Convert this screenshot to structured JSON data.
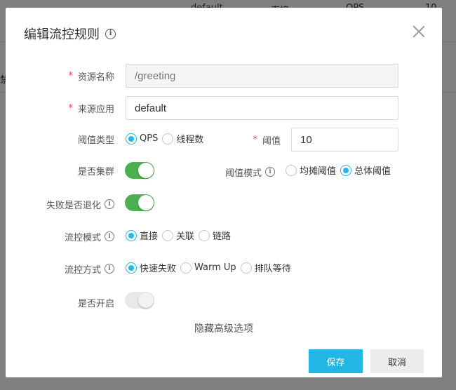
{
  "background": {
    "row1": [
      "default",
      "直接",
      "QPS",
      "10"
    ],
    "edge_text": "禁"
  },
  "modal": {
    "title": "编辑流控规则",
    "resource_label": "资源名称",
    "resource_value": "/greeting",
    "origin_label": "来源应用",
    "origin_value": "default",
    "threshold_type_label": "阈值类型",
    "threshold_type_options": [
      "QPS",
      "线程数"
    ],
    "threshold_label": "阈值",
    "threshold_value": "10",
    "cluster_label": "是否集群",
    "cluster_threshold_mode_label": "阈值模式",
    "cluster_threshold_mode_options": [
      "均摊阈值",
      "总体阈值"
    ],
    "fallback_label": "失败是否退化",
    "strategy_label": "流控模式",
    "strategy_options": [
      "直接",
      "关联",
      "链路"
    ],
    "control_behavior_label": "流控方式",
    "control_behavior_options": [
      "快速失败",
      "Warm Up",
      "排队等待"
    ],
    "enabled_label": "是否开启",
    "hide_advanced_link": "隐藏高级选项",
    "save_button": "保存",
    "cancel_button": "取消"
  },
  "state": {
    "threshold_type_selected": "QPS",
    "cluster_threshold_mode_selected": "总体阈值",
    "strategy_selected": "直接",
    "control_behavior_selected": "快速失败",
    "cluster_on": true,
    "fallback_on": true,
    "enabled_on": false
  },
  "colors": {
    "accent": "#23b7e5",
    "toggle_on": "#4caf50",
    "required": "#e64545"
  },
  "icons": [
    "info-icon",
    "close-icon"
  ]
}
